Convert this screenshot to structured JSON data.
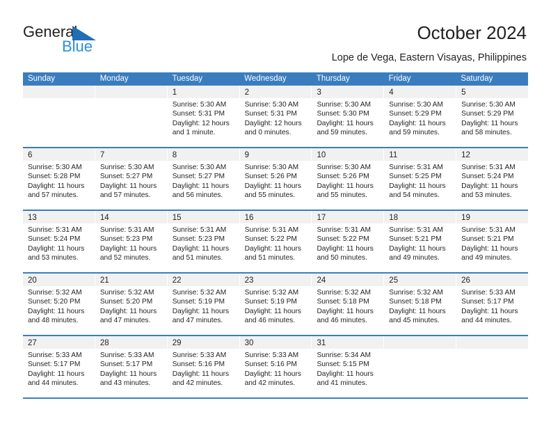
{
  "brand": {
    "name_top": "General",
    "name_bottom": "Blue",
    "triangle_color": "#1f6fb5",
    "blue_text_color": "#2b8fd4"
  },
  "header": {
    "title": "October 2024",
    "subtitle": "Lope de Vega, Eastern Visayas, Philippines"
  },
  "theme": {
    "header_blue": "#3a7dbf",
    "daynum_band": "#f1f1f1",
    "text": "#231f20"
  },
  "weekdays": [
    "Sunday",
    "Monday",
    "Tuesday",
    "Wednesday",
    "Thursday",
    "Friday",
    "Saturday"
  ],
  "weeks": [
    [
      {
        "day": "",
        "sunrise": "",
        "sunset": "",
        "daylight": ""
      },
      {
        "day": "",
        "sunrise": "",
        "sunset": "",
        "daylight": ""
      },
      {
        "day": "1",
        "sunrise": "Sunrise: 5:30 AM",
        "sunset": "Sunset: 5:31 PM",
        "daylight": "Daylight: 12 hours and 1 minute."
      },
      {
        "day": "2",
        "sunrise": "Sunrise: 5:30 AM",
        "sunset": "Sunset: 5:31 PM",
        "daylight": "Daylight: 12 hours and 0 minutes."
      },
      {
        "day": "3",
        "sunrise": "Sunrise: 5:30 AM",
        "sunset": "Sunset: 5:30 PM",
        "daylight": "Daylight: 11 hours and 59 minutes."
      },
      {
        "day": "4",
        "sunrise": "Sunrise: 5:30 AM",
        "sunset": "Sunset: 5:29 PM",
        "daylight": "Daylight: 11 hours and 59 minutes."
      },
      {
        "day": "5",
        "sunrise": "Sunrise: 5:30 AM",
        "sunset": "Sunset: 5:29 PM",
        "daylight": "Daylight: 11 hours and 58 minutes."
      }
    ],
    [
      {
        "day": "6",
        "sunrise": "Sunrise: 5:30 AM",
        "sunset": "Sunset: 5:28 PM",
        "daylight": "Daylight: 11 hours and 57 minutes."
      },
      {
        "day": "7",
        "sunrise": "Sunrise: 5:30 AM",
        "sunset": "Sunset: 5:27 PM",
        "daylight": "Daylight: 11 hours and 57 minutes."
      },
      {
        "day": "8",
        "sunrise": "Sunrise: 5:30 AM",
        "sunset": "Sunset: 5:27 PM",
        "daylight": "Daylight: 11 hours and 56 minutes."
      },
      {
        "day": "9",
        "sunrise": "Sunrise: 5:30 AM",
        "sunset": "Sunset: 5:26 PM",
        "daylight": "Daylight: 11 hours and 55 minutes."
      },
      {
        "day": "10",
        "sunrise": "Sunrise: 5:30 AM",
        "sunset": "Sunset: 5:26 PM",
        "daylight": "Daylight: 11 hours and 55 minutes."
      },
      {
        "day": "11",
        "sunrise": "Sunrise: 5:31 AM",
        "sunset": "Sunset: 5:25 PM",
        "daylight": "Daylight: 11 hours and 54 minutes."
      },
      {
        "day": "12",
        "sunrise": "Sunrise: 5:31 AM",
        "sunset": "Sunset: 5:24 PM",
        "daylight": "Daylight: 11 hours and 53 minutes."
      }
    ],
    [
      {
        "day": "13",
        "sunrise": "Sunrise: 5:31 AM",
        "sunset": "Sunset: 5:24 PM",
        "daylight": "Daylight: 11 hours and 53 minutes."
      },
      {
        "day": "14",
        "sunrise": "Sunrise: 5:31 AM",
        "sunset": "Sunset: 5:23 PM",
        "daylight": "Daylight: 11 hours and 52 minutes."
      },
      {
        "day": "15",
        "sunrise": "Sunrise: 5:31 AM",
        "sunset": "Sunset: 5:23 PM",
        "daylight": "Daylight: 11 hours and 51 minutes."
      },
      {
        "day": "16",
        "sunrise": "Sunrise: 5:31 AM",
        "sunset": "Sunset: 5:22 PM",
        "daylight": "Daylight: 11 hours and 51 minutes."
      },
      {
        "day": "17",
        "sunrise": "Sunrise: 5:31 AM",
        "sunset": "Sunset: 5:22 PM",
        "daylight": "Daylight: 11 hours and 50 minutes."
      },
      {
        "day": "18",
        "sunrise": "Sunrise: 5:31 AM",
        "sunset": "Sunset: 5:21 PM",
        "daylight": "Daylight: 11 hours and 49 minutes."
      },
      {
        "day": "19",
        "sunrise": "Sunrise: 5:31 AM",
        "sunset": "Sunset: 5:21 PM",
        "daylight": "Daylight: 11 hours and 49 minutes."
      }
    ],
    [
      {
        "day": "20",
        "sunrise": "Sunrise: 5:32 AM",
        "sunset": "Sunset: 5:20 PM",
        "daylight": "Daylight: 11 hours and 48 minutes."
      },
      {
        "day": "21",
        "sunrise": "Sunrise: 5:32 AM",
        "sunset": "Sunset: 5:20 PM",
        "daylight": "Daylight: 11 hours and 47 minutes."
      },
      {
        "day": "22",
        "sunrise": "Sunrise: 5:32 AM",
        "sunset": "Sunset: 5:19 PM",
        "daylight": "Daylight: 11 hours and 47 minutes."
      },
      {
        "day": "23",
        "sunrise": "Sunrise: 5:32 AM",
        "sunset": "Sunset: 5:19 PM",
        "daylight": "Daylight: 11 hours and 46 minutes."
      },
      {
        "day": "24",
        "sunrise": "Sunrise: 5:32 AM",
        "sunset": "Sunset: 5:18 PM",
        "daylight": "Daylight: 11 hours and 46 minutes."
      },
      {
        "day": "25",
        "sunrise": "Sunrise: 5:32 AM",
        "sunset": "Sunset: 5:18 PM",
        "daylight": "Daylight: 11 hours and 45 minutes."
      },
      {
        "day": "26",
        "sunrise": "Sunrise: 5:33 AM",
        "sunset": "Sunset: 5:17 PM",
        "daylight": "Daylight: 11 hours and 44 minutes."
      }
    ],
    [
      {
        "day": "27",
        "sunrise": "Sunrise: 5:33 AM",
        "sunset": "Sunset: 5:17 PM",
        "daylight": "Daylight: 11 hours and 44 minutes."
      },
      {
        "day": "28",
        "sunrise": "Sunrise: 5:33 AM",
        "sunset": "Sunset: 5:17 PM",
        "daylight": "Daylight: 11 hours and 43 minutes."
      },
      {
        "day": "29",
        "sunrise": "Sunrise: 5:33 AM",
        "sunset": "Sunset: 5:16 PM",
        "daylight": "Daylight: 11 hours and 42 minutes."
      },
      {
        "day": "30",
        "sunrise": "Sunrise: 5:33 AM",
        "sunset": "Sunset: 5:16 PM",
        "daylight": "Daylight: 11 hours and 42 minutes."
      },
      {
        "day": "31",
        "sunrise": "Sunrise: 5:34 AM",
        "sunset": "Sunset: 5:15 PM",
        "daylight": "Daylight: 11 hours and 41 minutes."
      },
      {
        "day": "",
        "sunrise": "",
        "sunset": "",
        "daylight": ""
      },
      {
        "day": "",
        "sunrise": "",
        "sunset": "",
        "daylight": ""
      }
    ]
  ]
}
